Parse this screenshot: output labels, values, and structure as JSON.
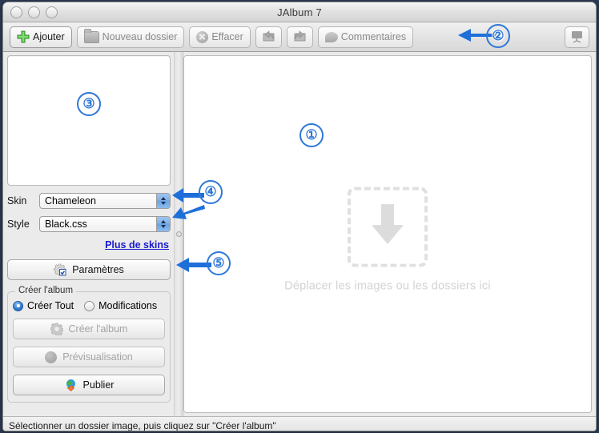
{
  "window": {
    "title": "JAlbum 7",
    "traffic_lights": [
      "close",
      "minimize",
      "zoom"
    ]
  },
  "toolbar": {
    "buttons": [
      {
        "label": "Ajouter",
        "icon": "green-plus-icon",
        "enabled": true
      },
      {
        "label": "Nouveau dossier",
        "icon": "folder-icon",
        "enabled": false
      },
      {
        "label": "Effacer",
        "icon": "delete-circle-icon",
        "enabled": false
      },
      {
        "label": "",
        "icon": "rotate-left-icon",
        "enabled": false
      },
      {
        "label": "",
        "icon": "rotate-right-icon",
        "enabled": false
      },
      {
        "label": "Commentaires",
        "icon": "comment-bubble-icon",
        "enabled": false
      }
    ],
    "right_button": {
      "label": "",
      "icon": "presentation-board-icon"
    }
  },
  "left_panel": {
    "skin": {
      "label": "Skin",
      "value": "Chameleon"
    },
    "style": {
      "label": "Style",
      "value": "Black.css"
    },
    "more_skins_link": "Plus de skins",
    "settings_button": {
      "label": "Paramètres",
      "icon": "gear-check-icon",
      "enabled": true
    },
    "album_group": {
      "title": "Créer l'album",
      "radios": [
        {
          "label": "Créer Tout",
          "selected": true
        },
        {
          "label": "Modifications",
          "selected": false
        }
      ],
      "create_button": {
        "label": "Créer l'album",
        "icon": "gear-icon",
        "enabled": false
      },
      "preview_button": {
        "label": "Prévisualisation",
        "icon": "preview-sphere-icon",
        "enabled": false
      },
      "publish_button": {
        "label": "Publier",
        "icon": "globe-upload-icon",
        "enabled": true
      }
    }
  },
  "main_panel": {
    "drop_text": "Déplacer les images ou les dossiers ici",
    "drop_icon": "download-arrow-icon"
  },
  "statusbar": {
    "text": "Sélectionner un dossier image, puis cliquez sur \"Créer l'album\""
  },
  "annotations": [
    {
      "number": "①",
      "target": "main-drop-panel"
    },
    {
      "number": "②",
      "target": "toolbar"
    },
    {
      "number": "③",
      "target": "file-list-panel"
    },
    {
      "number": "④",
      "target": "skin-style-dropdowns"
    },
    {
      "number": "⑤",
      "target": "settings-button"
    }
  ],
  "colors": {
    "annotation_blue": "#2f77d8",
    "link_blue": "#1a1ad0",
    "accent_green": "#5ec84f",
    "desktop_bg": "#2a3a52"
  }
}
